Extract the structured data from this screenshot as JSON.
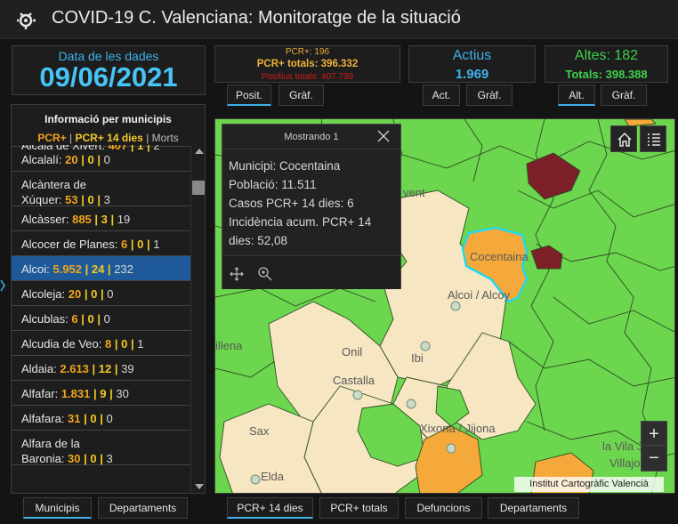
{
  "header": {
    "title": "COVID-19 C. Valenciana: Monitoratge de la situació",
    "logo_icon": "virus-logo-icon"
  },
  "date_panel": {
    "label": "Data de les dades",
    "value": "09/06/2021"
  },
  "pcr_panel": {
    "line1": "PCR+: 196",
    "line2": "PCR+ totals: 396.332",
    "line3": "Positius totals: 407.799",
    "tabs": [
      "Posit.",
      "Gràf."
    ]
  },
  "actius_panel": {
    "label": "Actius",
    "value": "1.969",
    "tabs": [
      "Act.",
      "Gràf."
    ]
  },
  "altes_panel": {
    "line1": "Altes: 182",
    "line2": "Totals: 398.388",
    "tabs": [
      "Alt.",
      "Gràf."
    ]
  },
  "municipis": {
    "title": "Informació per municipis",
    "legend": {
      "pcr": "PCR+",
      "sep1": " | ",
      "pcr14": "PCR+ 14 dies",
      "sep2": " | ",
      "morts": "Morts"
    },
    "rows": [
      {
        "name": "Alcalà de Xivert:",
        "v1": "407",
        "v2": "1",
        "v3": "2"
      },
      {
        "name": "Alcalalí:",
        "v1": "20",
        "v2": "0",
        "v3": "0"
      },
      {
        "name": "Alcàntera de",
        "name2": "Xúquer:",
        "v1": "53",
        "v2": "0",
        "v3": "3"
      },
      {
        "name": "Alcàsser:",
        "v1": "885",
        "v2": "3",
        "v3": "19"
      },
      {
        "name": "Alcocer de Planes:",
        "v1": "6",
        "v2": "0",
        "v3": "1"
      },
      {
        "name": "Alcoi:",
        "v1": "5.952",
        "v2": "24",
        "v3": "232",
        "selected": true
      },
      {
        "name": "Alcoleja:",
        "v1": "20",
        "v2": "0",
        "v3": "0"
      },
      {
        "name": "Alcublas:",
        "v1": "6",
        "v2": "0",
        "v3": "0"
      },
      {
        "name": "Alcudia de Veo:",
        "v1": "8",
        "v2": "0",
        "v3": "1"
      },
      {
        "name": "Aldaia:",
        "v1": "2.613",
        "v2": "12",
        "v3": "39"
      },
      {
        "name": "Alfafar:",
        "v1": "1.831",
        "v2": "9",
        "v3": "30"
      },
      {
        "name": "Alfafara:",
        "v1": "31",
        "v2": "0",
        "v3": "0"
      },
      {
        "name": "Alfara de la",
        "name2": "Baronia:",
        "v1": "30",
        "v2": "0",
        "v3": "3"
      }
    ],
    "value_sep": " | ",
    "tabs": [
      "Municipis",
      "Departaments"
    ]
  },
  "popup": {
    "header": "Mostrando 1",
    "lines": [
      "Municipi: Cocentaina",
      "Població: 11.511",
      "Casos PCR+ 14 dies: 6",
      "Incidència acum. PCR+ 14",
      "dies: 52,08"
    ]
  },
  "map": {
    "labels": {
      "cocentaina": "Cocentaina",
      "alcoi": "Alcoi / Alcoy",
      "onil": "Onil",
      "ibi": "Ibi",
      "castalla": "Castalla",
      "sax": "Sax",
      "xixona": "Xixona / Jijona",
      "villena": "illena",
      "vent": "vent",
      "vila_joiosa": "la Vila J",
      "villajo": "Villajo",
      "elda": "Elda"
    },
    "attribution": "Institut Cartogràfic Valencià",
    "zoom_in": "+",
    "zoom_out": "−",
    "colors": {
      "green": "#6cd64e",
      "cream": "#f6e6c2",
      "orange": "#f5a93b",
      "darkred": "#7c1f28",
      "highlight": "#22d8ee"
    },
    "tabs": [
      "PCR+ 14 dies",
      "PCR+ totals",
      "Defuncions",
      "Departaments"
    ]
  }
}
